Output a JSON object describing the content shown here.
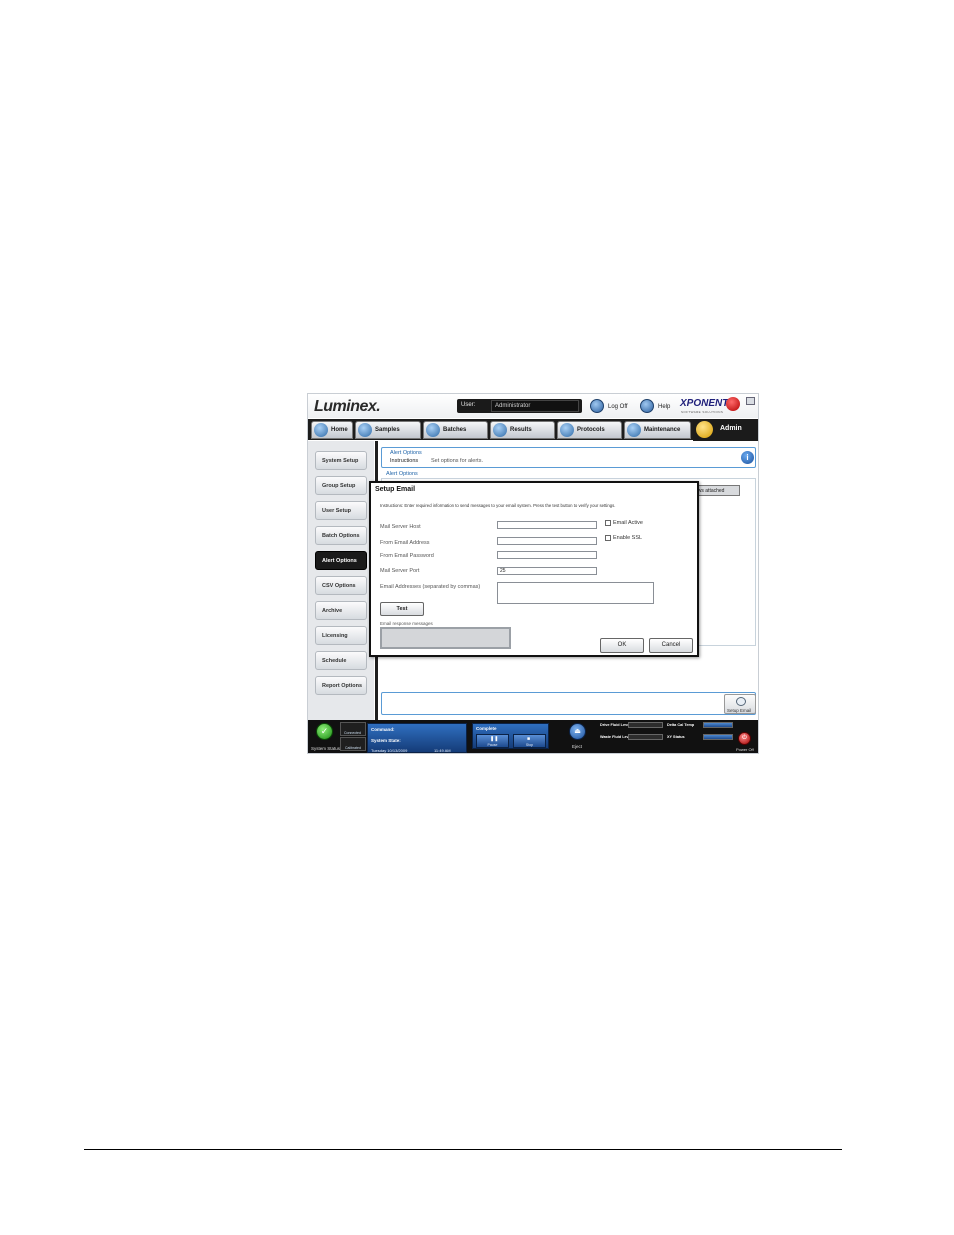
{
  "header": {
    "logo": "Luminex.",
    "user_label": "User:",
    "user_value": "Administrator",
    "logoff_label": "Log Off",
    "help_label": "Help",
    "brand": "XPONENT",
    "brand_sub": "SOFTWARE SOLUTIONS"
  },
  "nav": {
    "tabs": [
      {
        "label": "Home"
      },
      {
        "label": "Samples"
      },
      {
        "label": "Batches"
      },
      {
        "label": "Results"
      },
      {
        "label": "Protocols"
      },
      {
        "label": "Maintenance"
      },
      {
        "label": "Admin"
      }
    ],
    "active": "Admin"
  },
  "sidebar": {
    "items": [
      {
        "label": "System Setup"
      },
      {
        "label": "Group Setup"
      },
      {
        "label": "User Setup"
      },
      {
        "label": "Batch Options"
      },
      {
        "label": "Alert Options"
      },
      {
        "label": "CSV Options"
      },
      {
        "label": "Archive"
      },
      {
        "label": "Licensing"
      },
      {
        "label": "Schedule"
      },
      {
        "label": "Report Options"
      }
    ],
    "active": "Alert Options"
  },
  "main": {
    "panel_title": "Alert Options",
    "instructions_label": "Instructions",
    "instructions_text": "Set options for alerts.",
    "section_link": "Alert Options",
    "attached_text": "ews attached",
    "setup_email_label": "Setup Email"
  },
  "dialog": {
    "title": "Setup Email",
    "instructions": "Instructions: Enter required information to send messages to your email system. Press the test button to verify your settings.",
    "fields": {
      "mail_server_host": {
        "label": "Mail Server Host",
        "value": ""
      },
      "from_email_address": {
        "label": "From Email Address",
        "value": ""
      },
      "from_email_password": {
        "label": "From Email Password",
        "value": ""
      },
      "mail_server_port": {
        "label": "Mail Server Port",
        "value": "25"
      },
      "email_addresses": {
        "label": "Email Addresses (separated by commas)",
        "value": ""
      }
    },
    "email_active_label": "Email Active",
    "enable_ssl_label": "Enable SSL",
    "test_label": "Test",
    "response_label": "Email response messages",
    "ok_label": "OK",
    "cancel_label": "Cancel"
  },
  "status_bar": {
    "system_status_label": "System Status",
    "connected_label": "Connected",
    "calibrated_label": "Calibrated",
    "command_label": "Command:",
    "state_label": "System State:",
    "date": "Tuesday 10/13/2009",
    "time": "11:49 AM",
    "complete_label": "Complete",
    "pause_label": "Pause",
    "stop_label": "Stop",
    "eject_label": "Eject",
    "drive_fluid_label": "Drive Fluid Level",
    "waste_fluid_label": "Waste Fluid Level",
    "delta_cal_label": "Delta Cal Temp",
    "xy_status_label": "XY Status",
    "power_label": "Power Off"
  }
}
